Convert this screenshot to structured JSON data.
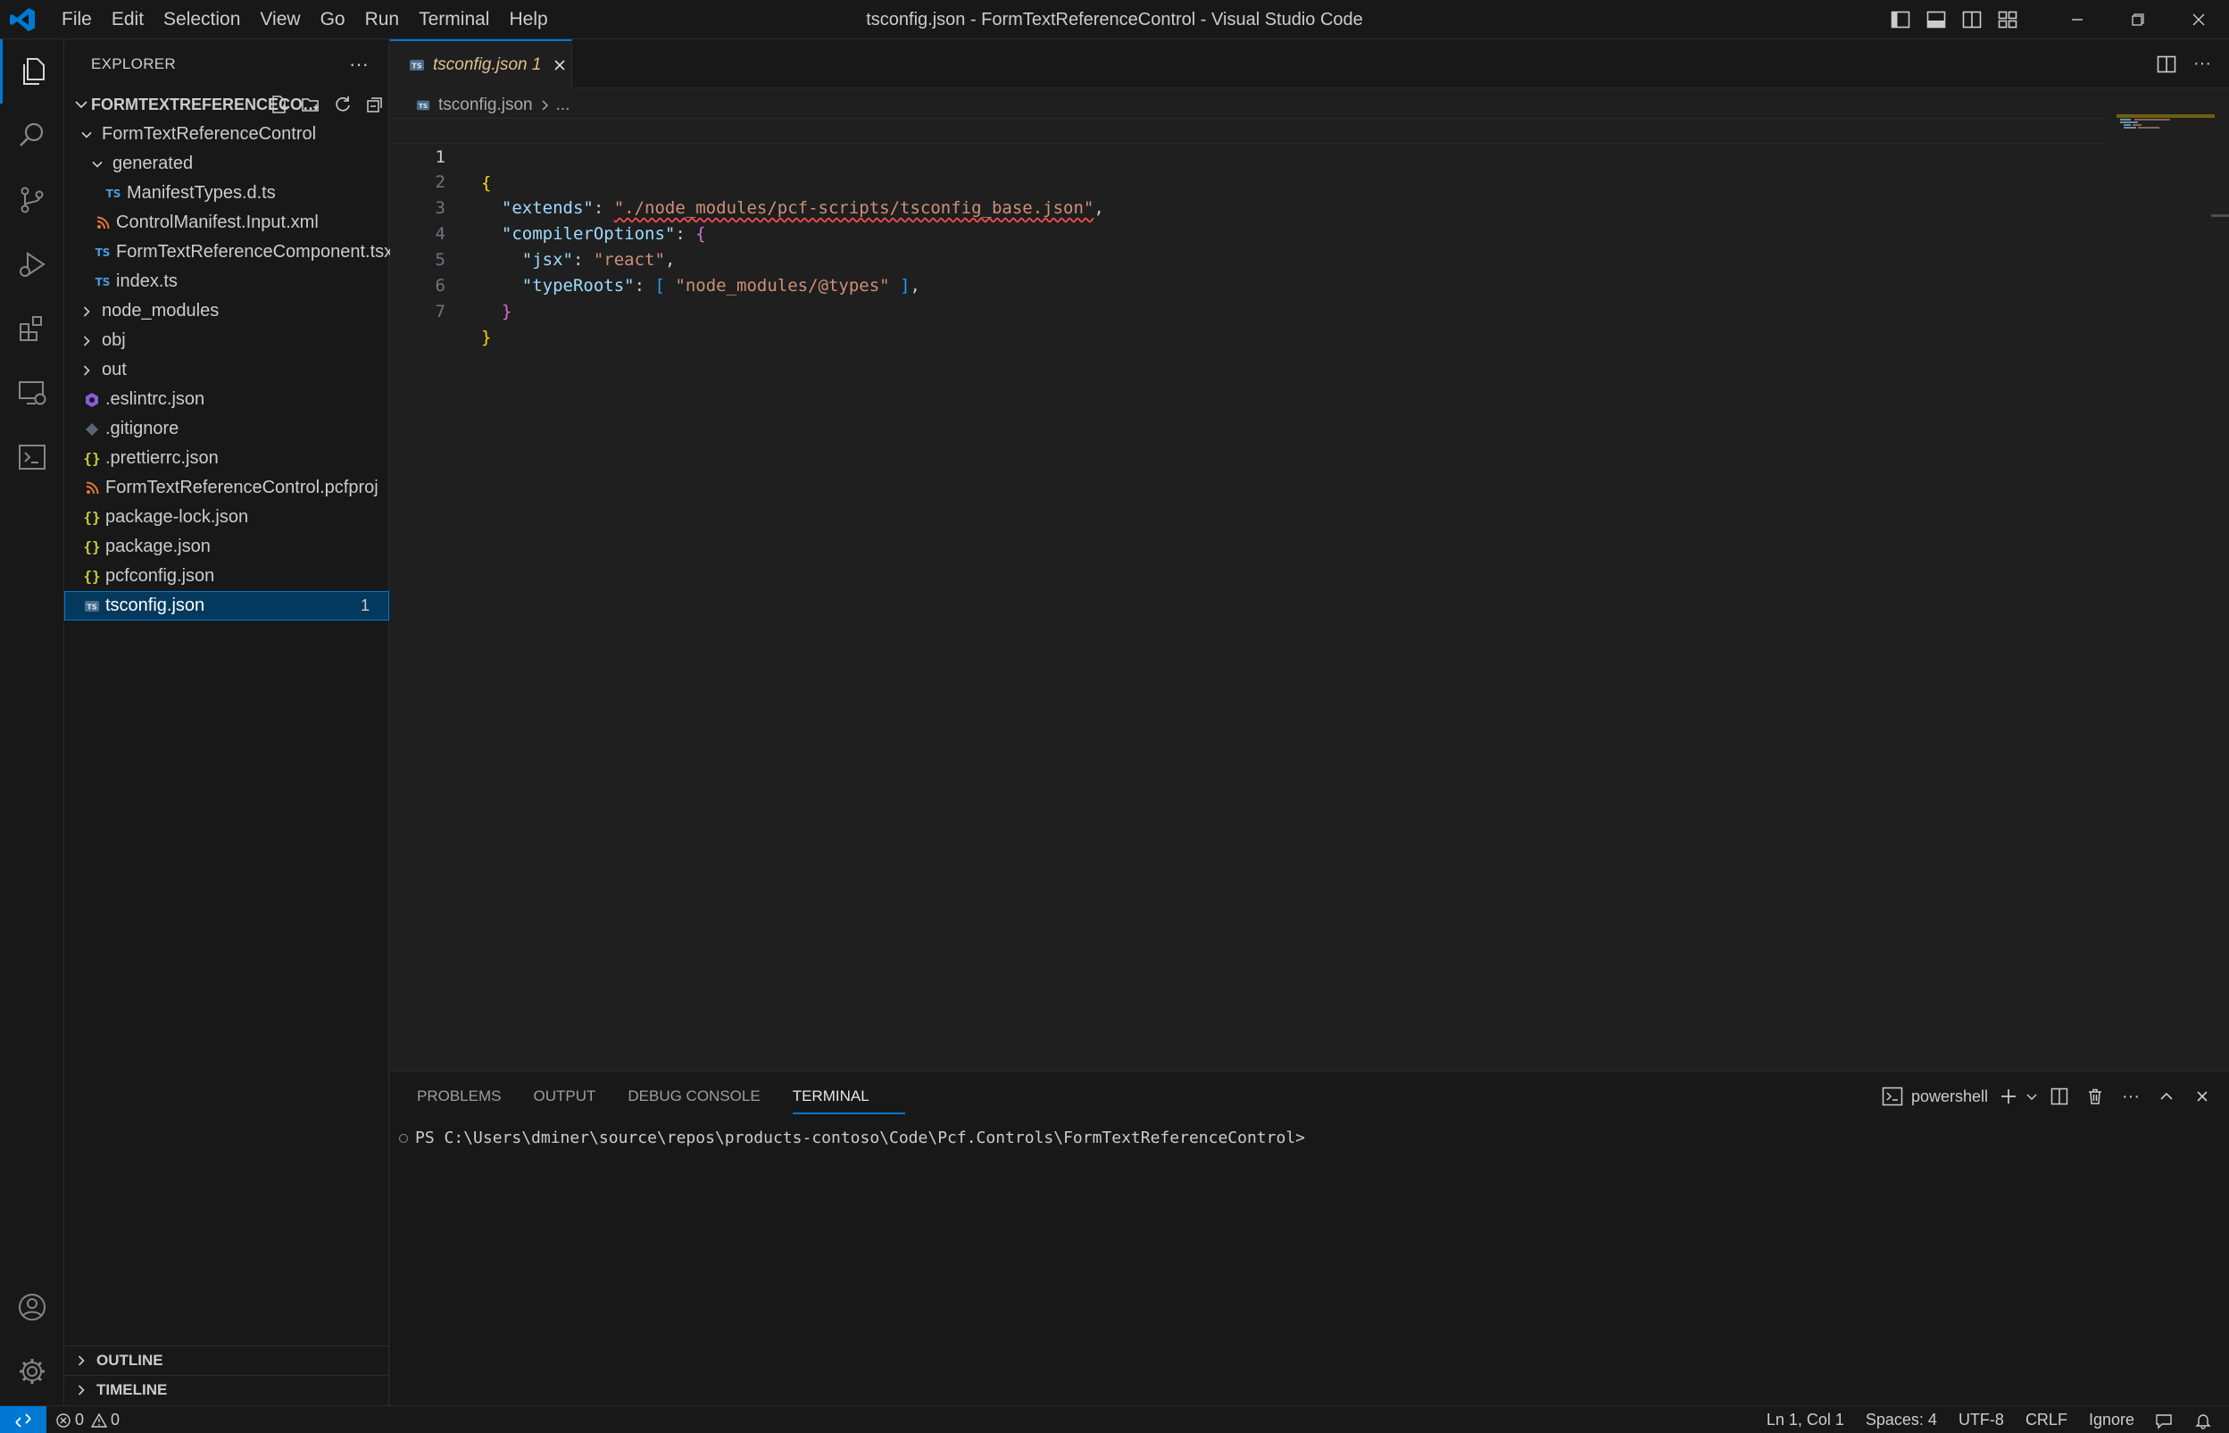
{
  "window": {
    "title": "tsconfig.json - FormTextReferenceControl - Visual Studio Code"
  },
  "menu": {
    "items": [
      "File",
      "Edit",
      "Selection",
      "View",
      "Go",
      "Run",
      "Terminal",
      "Help"
    ]
  },
  "sidebar": {
    "title": "EXPLORER",
    "more": "···",
    "folder_name": "FORMTEXTREFERENCECONTROL",
    "tree": [
      {
        "name": "FormTextReferenceControl",
        "kind": "folder-open"
      },
      {
        "name": "generated",
        "kind": "folder-open"
      },
      {
        "name": "ManifestTypes.d.ts",
        "kind": "ts"
      },
      {
        "name": "ControlManifest.Input.xml",
        "kind": "xml"
      },
      {
        "name": "FormTextReferenceComponent.tsx",
        "kind": "ts"
      },
      {
        "name": "index.ts",
        "kind": "ts"
      },
      {
        "name": "node_modules",
        "kind": "folder-closed"
      },
      {
        "name": "obj",
        "kind": "folder-closed"
      },
      {
        "name": "out",
        "kind": "folder-closed"
      },
      {
        "name": ".eslintrc.json",
        "kind": "eslint"
      },
      {
        "name": ".gitignore",
        "kind": "git"
      },
      {
        "name": ".prettierrc.json",
        "kind": "json"
      },
      {
        "name": "FormTextReferenceControl.pcfproj",
        "kind": "xml"
      },
      {
        "name": "package-lock.json",
        "kind": "json"
      },
      {
        "name": "package.json",
        "kind": "json"
      },
      {
        "name": "pcfconfig.json",
        "kind": "json"
      },
      {
        "name": "tsconfig.json",
        "kind": "tsconfig",
        "badge": "1",
        "selected": true
      }
    ],
    "ts_label": "TS",
    "json_label": "{}",
    "outline_label": "OUTLINE",
    "timeline_label": "TIMELINE"
  },
  "editor": {
    "tab": {
      "label": "tsconfig.json",
      "problems": "1"
    },
    "breadcrumb": {
      "file": "tsconfig.json",
      "rest": "..."
    },
    "more": "···",
    "line_numbers": [
      "1",
      "2",
      "3",
      "4",
      "5",
      "6",
      "7"
    ],
    "code": {
      "open_brace": "{",
      "extends_key": "\"extends\"",
      "extends_value": "\"./node_modules/pcf-scripts/tsconfig_base.json\"",
      "compiler_key": "\"compilerOptions\"",
      "compiler_open": "{",
      "jsx_key": "\"jsx\"",
      "jsx_value": "\"react\"",
      "typeroots_key": "\"typeRoots\"",
      "typeroots_open": "[",
      "typeroots_value": "\"node_modules/@types\"",
      "typeroots_close": "]",
      "compiler_close": "}",
      "close_brace": "}"
    }
  },
  "panel": {
    "tabs": [
      "PROBLEMS",
      "OUTPUT",
      "DEBUG CONSOLE",
      "TERMINAL"
    ],
    "active_tab": "TERMINAL",
    "terminal_profile": "powershell",
    "more": "···",
    "terminal_prompt": "PS C:\\Users\\dminer\\source\\repos\\products-contoso\\Code\\Pcf.Controls\\FormTextReferenceControl>"
  },
  "statusbar": {
    "errors": "0",
    "warnings": "0",
    "position": "Ln 1, Col 1",
    "spaces": "Spaces: 4",
    "encoding": "UTF-8",
    "eol": "CRLF",
    "language": "Ignore"
  },
  "colors": {
    "accent": "#0078d4",
    "ts_blue": "#4b9be0",
    "json_yellow": "#cbcb41",
    "xml_orange": "#e37933",
    "modified_tab": "#e2c08d"
  }
}
